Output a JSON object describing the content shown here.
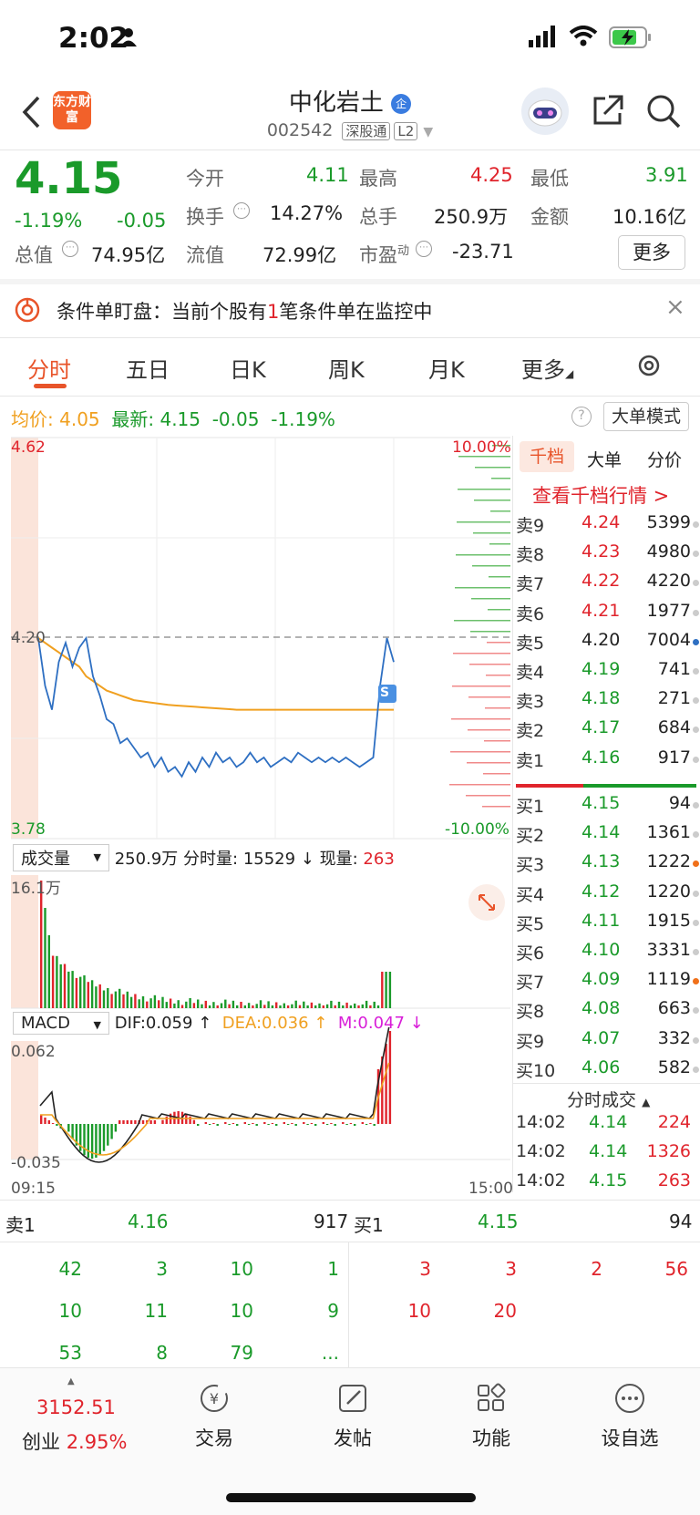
{
  "status_bar": {
    "time": "2:02"
  },
  "header": {
    "logo_text": "东方财富",
    "name": "中化岩土",
    "code": "002542",
    "tag1": "深股通",
    "tag2": "L2",
    "company_badge": "企"
  },
  "quote": {
    "price": "4.15",
    "change_pct": "-1.19%",
    "change": "-0.05",
    "open_label": "今开",
    "open": "4.11",
    "high_label": "最高",
    "high": "4.25",
    "low_label": "最低",
    "low": "3.91",
    "turnover_label": "换手",
    "turnover": "14.27%",
    "volume_label": "总手",
    "volume": "250.9万",
    "amount_label": "金额",
    "amount": "10.16亿",
    "mktcap_label": "总值",
    "mktcap": "74.95亿",
    "float_label": "流值",
    "float": "72.99亿",
    "pe_label": "市盈",
    "pe_sup": "动",
    "pe": "-23.71",
    "more": "更多"
  },
  "banner": {
    "prefix": "条件单盯盘：当前个股有",
    "count": "1",
    "suffix": "笔条件单在监控中"
  },
  "tabs": [
    "分时",
    "五日",
    "日K",
    "周K",
    "月K",
    "更多"
  ],
  "chart_info": {
    "avg_label": "均价:",
    "avg": "4.05",
    "last_label": "最新:",
    "last": "4.15",
    "chg": "-0.05",
    "chg_pct": "-1.19%",
    "mode_btn": "大单模式"
  },
  "chart": {
    "y_top": "4.62",
    "y_mid": "4.20",
    "y_bottom": "3.78",
    "pct_top": "10.00%",
    "pct_bottom": "-10.00%",
    "vol_label": "成交量",
    "vol_total": "250.9万",
    "vol_period_label": "分时量:",
    "vol_period": "15529",
    "vol_now_label": "现量:",
    "vol_now": "263",
    "vol_max": "16.1万",
    "macd_label": "MACD",
    "dif": "DIF:0.059",
    "dea": "DEA:0.036",
    "m": "M:0.047",
    "macd_top": "0.062",
    "macd_bottom": "-0.035",
    "t_start": "09:15",
    "t_end": "15:00"
  },
  "chart_data": {
    "type": "line",
    "price_range": [
      3.78,
      4.62
    ],
    "prev_close": 4.2,
    "series": [
      {
        "name": "最新",
        "color": "#2e6fc2",
        "values": [
          4.2,
          4.1,
          4.05,
          4.15,
          4.19,
          4.14,
          4.18,
          4.2,
          4.12,
          4.08,
          4.03,
          4.02,
          3.98,
          3.99,
          3.97,
          3.95,
          3.96,
          3.93,
          3.95,
          3.92,
          3.93,
          3.91,
          3.94,
          3.92,
          3.95,
          3.93,
          3.96,
          3.94,
          3.95,
          3.93,
          3.94,
          3.96,
          3.94,
          3.95,
          3.93,
          3.94,
          3.95,
          3.94,
          3.96,
          3.95,
          3.94,
          3.95,
          3.94,
          3.95,
          3.94,
          3.95,
          3.94,
          3.93,
          3.94,
          3.95,
          4.1,
          4.2,
          4.15
        ]
      },
      {
        "name": "均价",
        "color": "#f0a020",
        "values": [
          4.2,
          4.19,
          4.18,
          4.17,
          4.16,
          4.15,
          4.14,
          4.12,
          4.11,
          4.1,
          4.09,
          4.085,
          4.08,
          4.075,
          4.07,
          4.068,
          4.066,
          4.064,
          4.062,
          4.06,
          4.059,
          4.058,
          4.057,
          4.056,
          4.055,
          4.054,
          4.053,
          4.052,
          4.051,
          4.05,
          4.05,
          4.05,
          4.05,
          4.05,
          4.05,
          4.05,
          4.05,
          4.05,
          4.05,
          4.05,
          4.05,
          4.05,
          4.05,
          4.05,
          4.05,
          4.05,
          4.05,
          4.05,
          4.05,
          4.05,
          4.05,
          4.05,
          4.05
        ]
      }
    ]
  },
  "order_book": {
    "tabs": [
      "千档",
      "大单",
      "分价"
    ],
    "link": "查看千档行情 >",
    "sells": [
      {
        "label": "卖9",
        "price": "4.24",
        "vol": "5399",
        "price_color": "red"
      },
      {
        "label": "卖8",
        "price": "4.23",
        "vol": "4980",
        "price_color": "red"
      },
      {
        "label": "卖7",
        "price": "4.22",
        "vol": "4220",
        "price_color": "red"
      },
      {
        "label": "卖6",
        "price": "4.21",
        "vol": "1977",
        "price_color": "red"
      },
      {
        "label": "卖5",
        "price": "4.20",
        "vol": "7004",
        "price_color": "black"
      },
      {
        "label": "卖4",
        "price": "4.19",
        "vol": "741",
        "price_color": "green"
      },
      {
        "label": "卖3",
        "price": "4.18",
        "vol": "271",
        "price_color": "green"
      },
      {
        "label": "卖2",
        "price": "4.17",
        "vol": "684",
        "price_color": "green"
      },
      {
        "label": "卖1",
        "price": "4.16",
        "vol": "917",
        "price_color": "green"
      }
    ],
    "buys": [
      {
        "label": "买1",
        "price": "4.15",
        "vol": "94"
      },
      {
        "label": "买2",
        "price": "4.14",
        "vol": "1361"
      },
      {
        "label": "买3",
        "price": "4.13",
        "vol": "1222"
      },
      {
        "label": "买4",
        "price": "4.12",
        "vol": "1220"
      },
      {
        "label": "买5",
        "price": "4.11",
        "vol": "1915"
      },
      {
        "label": "买6",
        "price": "4.10",
        "vol": "3331"
      },
      {
        "label": "买7",
        "price": "4.09",
        "vol": "1119"
      },
      {
        "label": "买8",
        "price": "4.08",
        "vol": "663"
      },
      {
        "label": "买9",
        "price": "4.07",
        "vol": "332"
      },
      {
        "label": "买10",
        "price": "4.06",
        "vol": "582"
      }
    ],
    "ticks_title": "分时成交",
    "ticks": [
      {
        "time": "14:02",
        "price": "4.14",
        "vol": "224"
      },
      {
        "time": "14:02",
        "price": "4.14",
        "vol": "1326"
      },
      {
        "time": "14:02",
        "price": "4.15",
        "vol": "263"
      }
    ]
  },
  "queue": {
    "sell_label": "卖1",
    "sell_price": "4.16",
    "sell_total": "917",
    "buy_label": "买1",
    "buy_price": "4.15",
    "buy_total": "94",
    "sell_orders": [
      "42",
      "3",
      "10",
      "1",
      "10",
      "11",
      "10",
      "9",
      "53",
      "8",
      "79",
      "..."
    ],
    "buy_orders": [
      "3",
      "3",
      "2",
      "56",
      "10",
      "20"
    ]
  },
  "bottom_nav": {
    "index_value": "3152.51",
    "index_name": "创业",
    "index_pct": "2.95%",
    "items": [
      "交易",
      "发帖",
      "功能",
      "设自选"
    ]
  }
}
